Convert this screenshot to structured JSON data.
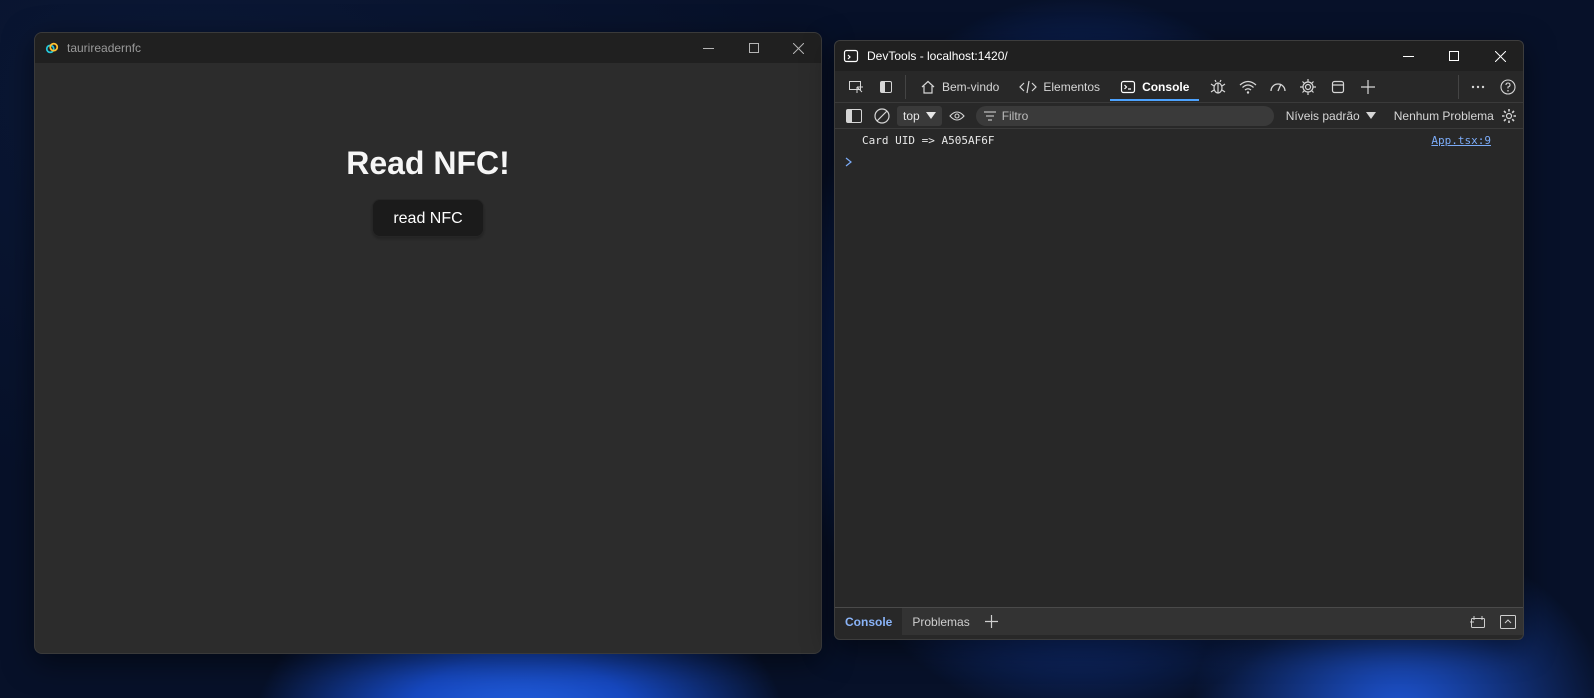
{
  "app": {
    "window_title": "taurireadernfc",
    "heading": "Read NFC!",
    "button_label": "read NFC",
    "controls": {
      "minimize": "—",
      "maximize": "☐",
      "close": "✕"
    }
  },
  "devtools": {
    "window_title": "DevTools - localhost:1420/",
    "tabs": [
      {
        "label": "Bem-vindo",
        "icon": "home-icon"
      },
      {
        "label": "Elementos",
        "icon": "code-icon"
      },
      {
        "label": "Console",
        "icon": "console-icon",
        "active": true
      }
    ],
    "toolbar": {
      "context": "top",
      "filter_placeholder": "Filtro",
      "levels": "Níveis padrão",
      "issues": "Nenhum Problema"
    },
    "console": {
      "messages": [
        {
          "text": "Card UID => A505AF6F",
          "source": "App.tsx:9"
        }
      ]
    },
    "drawer": {
      "tabs": [
        {
          "label": "Console",
          "active": true
        },
        {
          "label": "Problemas",
          "active": false
        }
      ]
    }
  },
  "colors": {
    "accent": "#4da3ff",
    "link": "#7cacf8",
    "app_bg": "#2c2c2c",
    "devtools_bg": "#282828"
  }
}
